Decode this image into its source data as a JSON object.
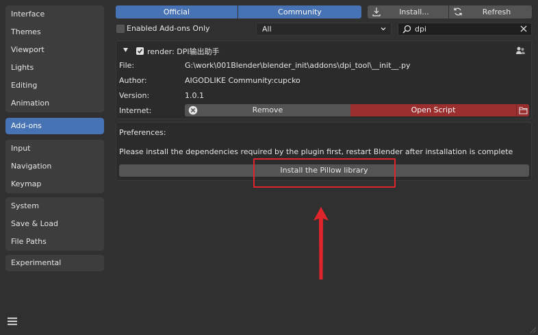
{
  "sidebar": {
    "groups": [
      [
        "Interface",
        "Themes",
        "Viewport",
        "Lights",
        "Editing",
        "Animation"
      ],
      [
        "Add-ons"
      ],
      [
        "Input",
        "Navigation",
        "Keymap"
      ],
      [
        "System",
        "Save & Load",
        "File Paths"
      ],
      [
        "Experimental"
      ]
    ],
    "active": "Add-ons"
  },
  "topbar": {
    "official_label": "Official",
    "community_label": "Community",
    "install_label": "Install...",
    "refresh_label": "Refresh"
  },
  "filter": {
    "enabled_only_label": "Enabled Add-ons Only",
    "enabled_only_checked": false,
    "category_value": "All",
    "search_value": "dpi"
  },
  "addon": {
    "expanded": true,
    "enabled": true,
    "title": "render: DPI输出助手",
    "fields": [
      {
        "label": "File:",
        "value": "G:\\work\\001Blender\\blender_init\\addons\\dpi_tool\\__init__.py"
      },
      {
        "label": "Author:",
        "value": "AIGODLIKE Community:cupcko"
      },
      {
        "label": "Version:",
        "value": "1.0.1"
      }
    ],
    "internet_label": "Internet:",
    "remove_label": "Remove",
    "open_script_label": "Open Script"
  },
  "preferences": {
    "title": "Preferences:",
    "message": "Please install the dependencies required by the plugin first, restart Blender after installation is complete",
    "install_button_label": "Install the Pillow library"
  },
  "colors": {
    "accent": "#4772b3",
    "danger": "#9b2e2e",
    "annotation": "#e0242b"
  }
}
